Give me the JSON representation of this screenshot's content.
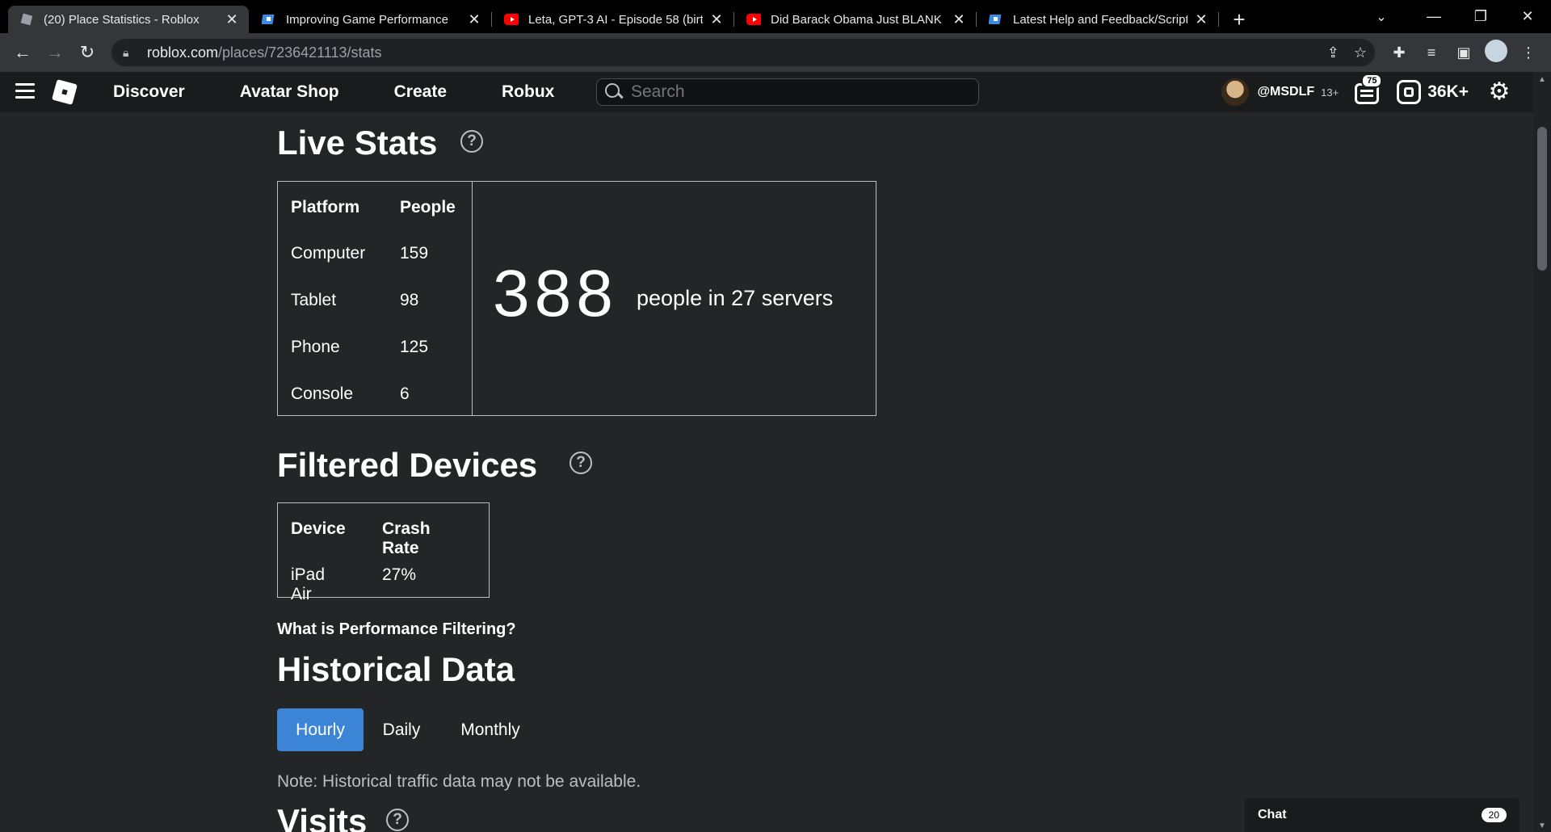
{
  "browser": {
    "tabs": [
      {
        "title": "(20) Place Statistics - Roblox",
        "favicon": "roblox-icon",
        "active": true
      },
      {
        "title": "Improving Game Performance",
        "favicon": "roblox-studio-icon",
        "active": false
      },
      {
        "title": "Leta, GPT-3 AI - Episode 58 (birth",
        "favicon": "youtube-icon",
        "active": false
      },
      {
        "title": "Did Barack Obama Just BLANK Jo",
        "favicon": "youtube-icon",
        "active": false
      },
      {
        "title": "Latest Help and Feedback/Scripti",
        "favicon": "roblox-studio-icon",
        "active": false
      }
    ],
    "url_host": "roblox.com",
    "url_path": "/places/7236421113/stats"
  },
  "header": {
    "nav": [
      "Discover",
      "Avatar Shop",
      "Create",
      "Robux"
    ],
    "search_placeholder": "Search",
    "username": "@MSDLF",
    "age_badge": "13+",
    "notification_count": "75",
    "robux": "36K+"
  },
  "live_stats": {
    "title": "Live Stats",
    "col_platform": "Platform",
    "col_people": "People",
    "rows": [
      {
        "platform": "Computer",
        "people": "159"
      },
      {
        "platform": "Tablet",
        "people": "98"
      },
      {
        "platform": "Phone",
        "people": "125"
      },
      {
        "platform": "Console",
        "people": "6"
      }
    ],
    "total": "388",
    "summary_pre": "people in",
    "servers": "27",
    "summary_post": "servers"
  },
  "filtered_devices": {
    "title": "Filtered Devices",
    "col_device": "Device",
    "col_crash": "Crash Rate",
    "rows": [
      {
        "device": "iPad Air",
        "crash_rate": "27%"
      }
    ],
    "link": "What is Performance Filtering?"
  },
  "historical": {
    "title": "Historical Data",
    "tabs": [
      "Hourly",
      "Daily",
      "Monthly"
    ],
    "active_tab": "Hourly",
    "note": "Note: Historical traffic data may not be available."
  },
  "visits": {
    "title": "Visits"
  },
  "chat": {
    "label": "Chat",
    "count": "20"
  },
  "colors": {
    "background": "#232527",
    "header": "#191b1d",
    "accent": "#3c84d6"
  }
}
